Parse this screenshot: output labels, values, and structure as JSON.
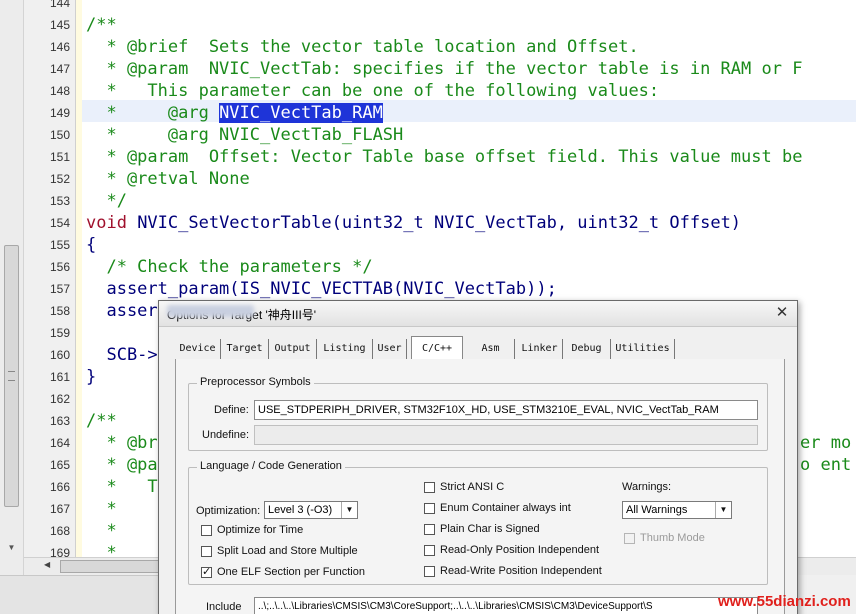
{
  "editor": {
    "lines": [
      {
        "no": "144",
        "text": ""
      },
      {
        "no": "145",
        "text": "/**"
      },
      {
        "no": "146",
        "text": "  * @brief  Sets the vector table location and Offset."
      },
      {
        "no": "147",
        "text": "  * @param  NVIC_VectTab: specifies if the vector table is in RAM or F"
      },
      {
        "no": "148",
        "text": "  *   This parameter can be one of the following values:"
      },
      {
        "no": "149",
        "text_pre": "  *     @arg ",
        "selected": "NVIC_VectTab_RAM"
      },
      {
        "no": "150",
        "text": "  *     @arg NVIC_VectTab_FLASH"
      },
      {
        "no": "151",
        "text": "  * @param  Offset: Vector Table base offset field. This value must be"
      },
      {
        "no": "152",
        "text": "  * @retval None"
      },
      {
        "no": "153",
        "text": "  */"
      },
      {
        "no": "154",
        "kw": "void",
        "text": " NVIC_SetVectorTable(uint32_t NVIC_VectTab, uint32_t Offset)"
      },
      {
        "no": "155",
        "text": "{"
      },
      {
        "no": "156",
        "text": "  /* Check the parameters */"
      },
      {
        "no": "157",
        "text": "  assert_param(IS_NVIC_VECTTAB(NVIC_VectTab));"
      },
      {
        "no": "158",
        "text": "  asser"
      },
      {
        "no": "159",
        "text": ""
      },
      {
        "no": "160",
        "text": "  SCB->"
      },
      {
        "no": "161",
        "text": "}"
      },
      {
        "no": "162",
        "text": ""
      },
      {
        "no": "163",
        "text": "/**"
      },
      {
        "no": "164",
        "text": "  * @br",
        "tail": "er mo"
      },
      {
        "no": "165",
        "text": "  * @pa",
        "tail": "o ent"
      },
      {
        "no": "166",
        "text": "  *   T"
      },
      {
        "no": "167",
        "text": "  *"
      },
      {
        "no": "168",
        "text": "  *"
      },
      {
        "no": "169",
        "text": "  *"
      }
    ]
  },
  "dialog": {
    "title": "Options for Target '神舟III号'",
    "close": "✕",
    "tabs": [
      "Device",
      "Target",
      "Output",
      "Listing",
      "User",
      "C/C++",
      "Asm",
      "Linker",
      "Debug",
      "Utilities"
    ],
    "active_tab": "C/C++",
    "preprocessor": {
      "group_label": "Preprocessor Symbols",
      "define_label": "Define:",
      "define_value": "USE_STDPERIPH_DRIVER, STM32F10X_HD, USE_STM3210E_EVAL, NVIC_VectTab_RAM",
      "undefine_label": "Undefine:",
      "undefine_value": ""
    },
    "language": {
      "group_label": "Language / Code Generation",
      "optimization_label": "Optimization:",
      "optimization_value": "Level 3 (-O3)",
      "optimize_for_time": {
        "label": "Optimize for Time",
        "checked": false
      },
      "split_load_store": {
        "label": "Split Load and Store Multiple",
        "checked": false
      },
      "one_elf_section": {
        "label": "One ELF Section per Function",
        "checked": true
      },
      "strict_ansi": {
        "label": "Strict ANSI C",
        "checked": false
      },
      "enum_container": {
        "label": "Enum Container always int",
        "checked": false
      },
      "plain_char": {
        "label": "Plain Char is Signed",
        "checked": false
      },
      "ropi": {
        "label": "Read-Only Position Independent",
        "checked": false
      },
      "rwpi": {
        "label": "Read-Write Position Independent",
        "checked": false
      },
      "warnings_label": "Warnings:",
      "warnings_value": "All Warnings",
      "thumb_mode": {
        "label": "Thumb Mode",
        "checked": false
      }
    },
    "include": {
      "label": "Include",
      "value": "..\\;..\\..\\..\\Libraries\\CMSIS\\CM3\\CoreSupport;..\\..\\..\\Libraries\\CMSIS\\CM3\\DeviceSupport\\S"
    }
  },
  "watermark": "www.55dianzi.com"
}
